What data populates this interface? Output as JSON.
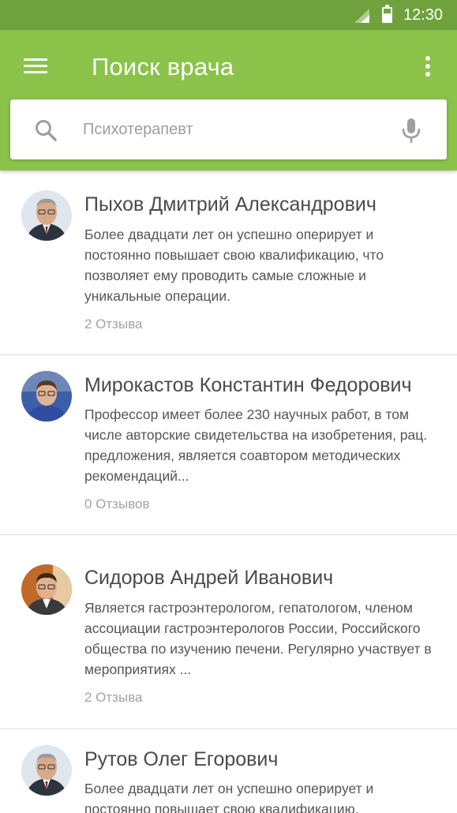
{
  "status_bar": {
    "time": "12:30",
    "signal_icon": "signal-icon",
    "battery_icon": "battery-icon"
  },
  "app_bar": {
    "title": "Поиск врача",
    "menu_icon": "menu-icon",
    "more_icon": "more-vert-icon",
    "color": "#8bc34a"
  },
  "search": {
    "placeholder": "Психотерапевт",
    "value": "",
    "search_icon": "search-icon",
    "mic_icon": "mic-icon"
  },
  "doctors": [
    {
      "name": "Пыхов Дмитрий Александрович",
      "description": "Более двадцати лет он успешно оперирует и постоянно повышает свою квалификацию, что позволяет ему проводить самые сложные и уникальные операции.",
      "reviews": "2 Отзыва"
    },
    {
      "name": "Мирокастов Константин Федорович",
      "description": "Профессор имеет более 230 научных работ, в том числе авторские свидетельства на изобретения, рац. предложения, является соавтором методических рекомендаций...",
      "reviews": "0 Отзывов"
    },
    {
      "name": "Сидоров Андрей Иванович",
      "description": "Является гастроэнтерологом, гепатологом, членом ассоциации гастроэнтерологов России, Российского общества по изучению печени. Регулярно участвует в мероприятиях ...",
      "reviews": "2 Отзыва"
    },
    {
      "name": "Рутов Олег Егорович",
      "description": "Более двадцати лет он успешно оперирует и постоянно повышает свою квалификацию.",
      "reviews": ""
    }
  ]
}
